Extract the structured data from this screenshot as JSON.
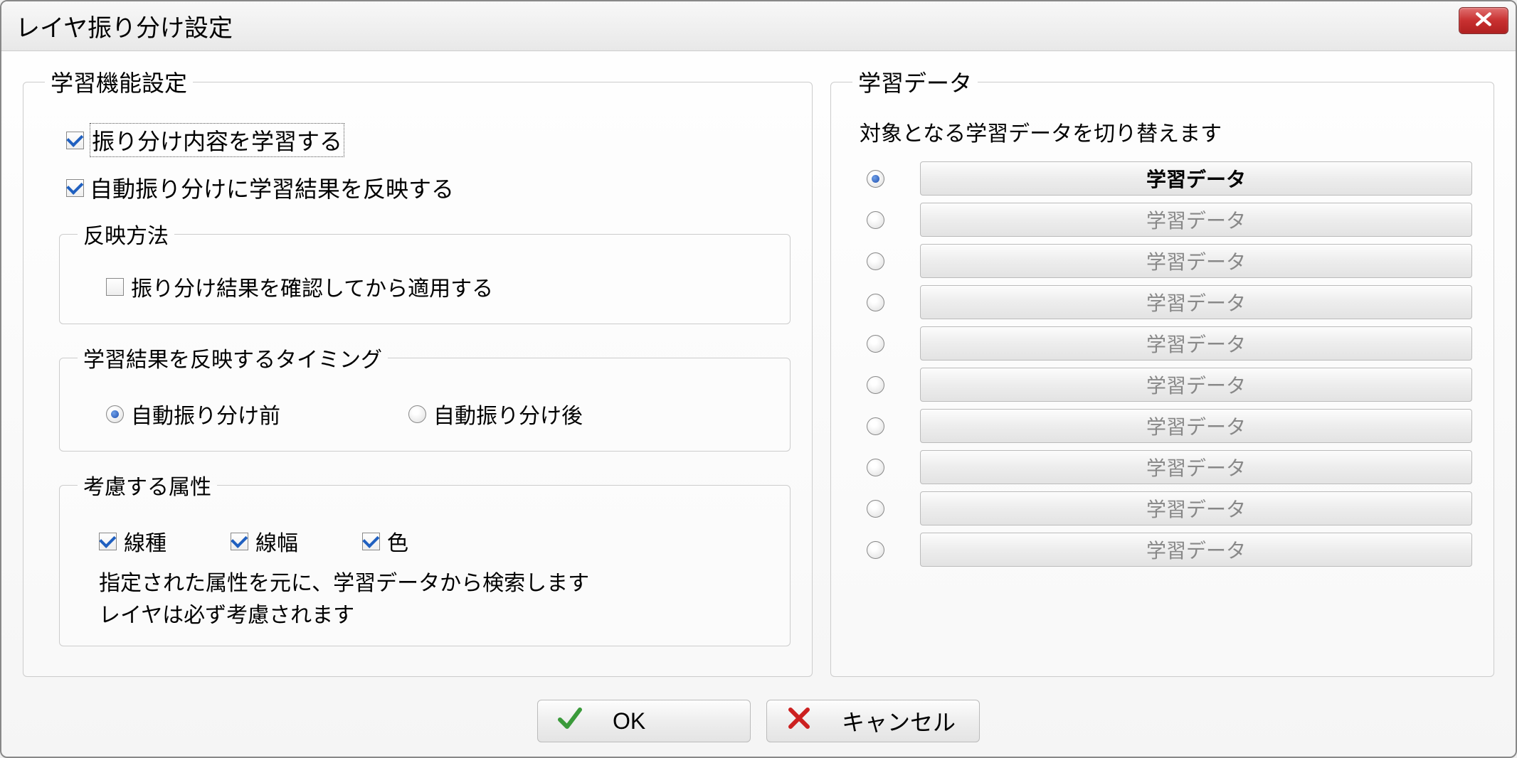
{
  "window": {
    "title": "レイヤ振り分け設定"
  },
  "left": {
    "group_title": "学習機能設定",
    "learn_checkbox": {
      "label": "振り分け内容を学習する",
      "checked": true
    },
    "reflect_checkbox": {
      "label": "自動振り分けに学習結果を反映する",
      "checked": true
    },
    "reflect_method": {
      "title": "反映方法",
      "confirm_checkbox": {
        "label": "振り分け結果を確認してから適用する",
        "checked": false
      }
    },
    "timing": {
      "title": "学習結果を反映するタイミング",
      "options": [
        {
          "label": "自動振り分け前",
          "selected": true
        },
        {
          "label": "自動振り分け後",
          "selected": false
        }
      ]
    },
    "attributes": {
      "title": "考慮する属性",
      "items": [
        {
          "label": "線種",
          "checked": true
        },
        {
          "label": "線幅",
          "checked": true
        },
        {
          "label": "色",
          "checked": true
        }
      ],
      "help1": "指定された属性を元に、学習データから検索します",
      "help2": "レイヤは必ず考慮されます"
    }
  },
  "right": {
    "group_title": "学習データ",
    "description": "対象となる学習データを切り替えます",
    "items": [
      {
        "label": "学習データ",
        "selected": true
      },
      {
        "label": "学習データ",
        "selected": false
      },
      {
        "label": "学習データ",
        "selected": false
      },
      {
        "label": "学習データ",
        "selected": false
      },
      {
        "label": "学習データ",
        "selected": false
      },
      {
        "label": "学習データ",
        "selected": false
      },
      {
        "label": "学習データ",
        "selected": false
      },
      {
        "label": "学習データ",
        "selected": false
      },
      {
        "label": "学習データ",
        "selected": false
      },
      {
        "label": "学習データ",
        "selected": false
      }
    ]
  },
  "buttons": {
    "ok": "OK",
    "cancel": "キャンセル"
  }
}
